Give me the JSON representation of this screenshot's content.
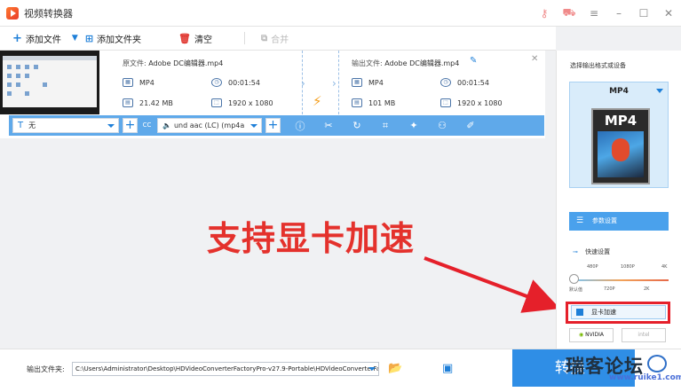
{
  "app": {
    "title": "视频转换器"
  },
  "titlebar_icons": [
    "key-icon",
    "cart-icon",
    "menu-icon",
    "minimize-icon",
    "maximize-icon",
    "close-icon"
  ],
  "toolbar": {
    "add_file": "添加文件",
    "add_folder": "添加文件夹",
    "clear": "清空",
    "merge": "合并"
  },
  "task": {
    "source_label": "原文件:",
    "source_name": "Adobe DC编辑器.mp4",
    "output_label": "输出文件:",
    "output_name": "Adobe DC编辑器.mp4",
    "src_format": "MP4",
    "src_duration": "00:01:54",
    "src_size": "21.42 MB",
    "src_resolution": "1920 x 1080",
    "out_format": "MP4",
    "out_duration": "00:01:54",
    "out_size": "101 MB",
    "out_resolution": "1920 x 1080"
  },
  "options": {
    "subtitle_value": "无",
    "audio_value": "und aac (LC) (mp4a",
    "cc_label": "CC"
  },
  "overlay": {
    "caption": "支持显卡加速"
  },
  "right_panel": {
    "title": "选择输出格式或设备",
    "format_name": "MP4",
    "format_icon_text": "MP4",
    "param_button": "参数设置",
    "speed_title": "快速设置",
    "ticks_top": [
      "480P",
      "1080P",
      "4K"
    ],
    "ticks_bottom": [
      "默认值",
      "720P",
      "2K"
    ],
    "gpu_label": "显卡加速",
    "nvidia": "NVIDIA",
    "intel": "intel"
  },
  "bottom": {
    "output_folder_label": "输出文件夹:",
    "output_path": "C:\\Users\\Administrator\\Desktop\\HDVideoConverterFactoryPro-v27.9-Portable\\HDVideoConverterFactor",
    "convert_label": "转换",
    "watermark": "瑞客论坛",
    "watermark_url": "www.ruike1.com"
  },
  "colors": {
    "accent": "#2f8ee6",
    "highlight": "#e5202a",
    "bar": "#5fa9ea"
  }
}
